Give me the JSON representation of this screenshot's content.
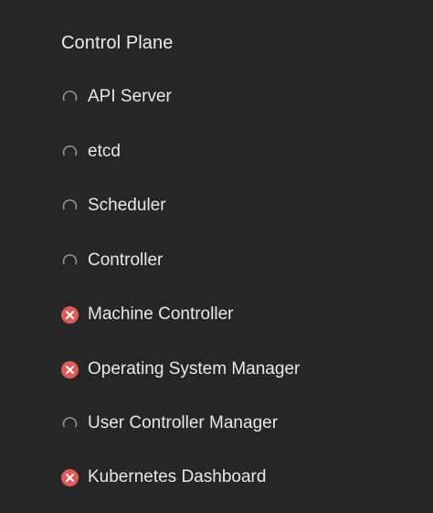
{
  "section": {
    "title": "Control Plane"
  },
  "colors": {
    "background": "#262626",
    "error": "#e05a58",
    "pending": "#9a9a9a"
  },
  "components": [
    {
      "label": "API Server",
      "status": "pending",
      "icon": "spinner-icon"
    },
    {
      "label": "etcd",
      "status": "pending",
      "icon": "spinner-icon"
    },
    {
      "label": "Scheduler",
      "status": "pending",
      "icon": "spinner-icon"
    },
    {
      "label": "Controller",
      "status": "pending",
      "icon": "spinner-icon"
    },
    {
      "label": "Machine Controller",
      "status": "error",
      "icon": "error-icon"
    },
    {
      "label": "Operating System Manager",
      "status": "error",
      "icon": "error-icon"
    },
    {
      "label": "User Controller Manager",
      "status": "pending",
      "icon": "spinner-icon"
    },
    {
      "label": "Kubernetes Dashboard",
      "status": "error",
      "icon": "error-icon"
    }
  ]
}
